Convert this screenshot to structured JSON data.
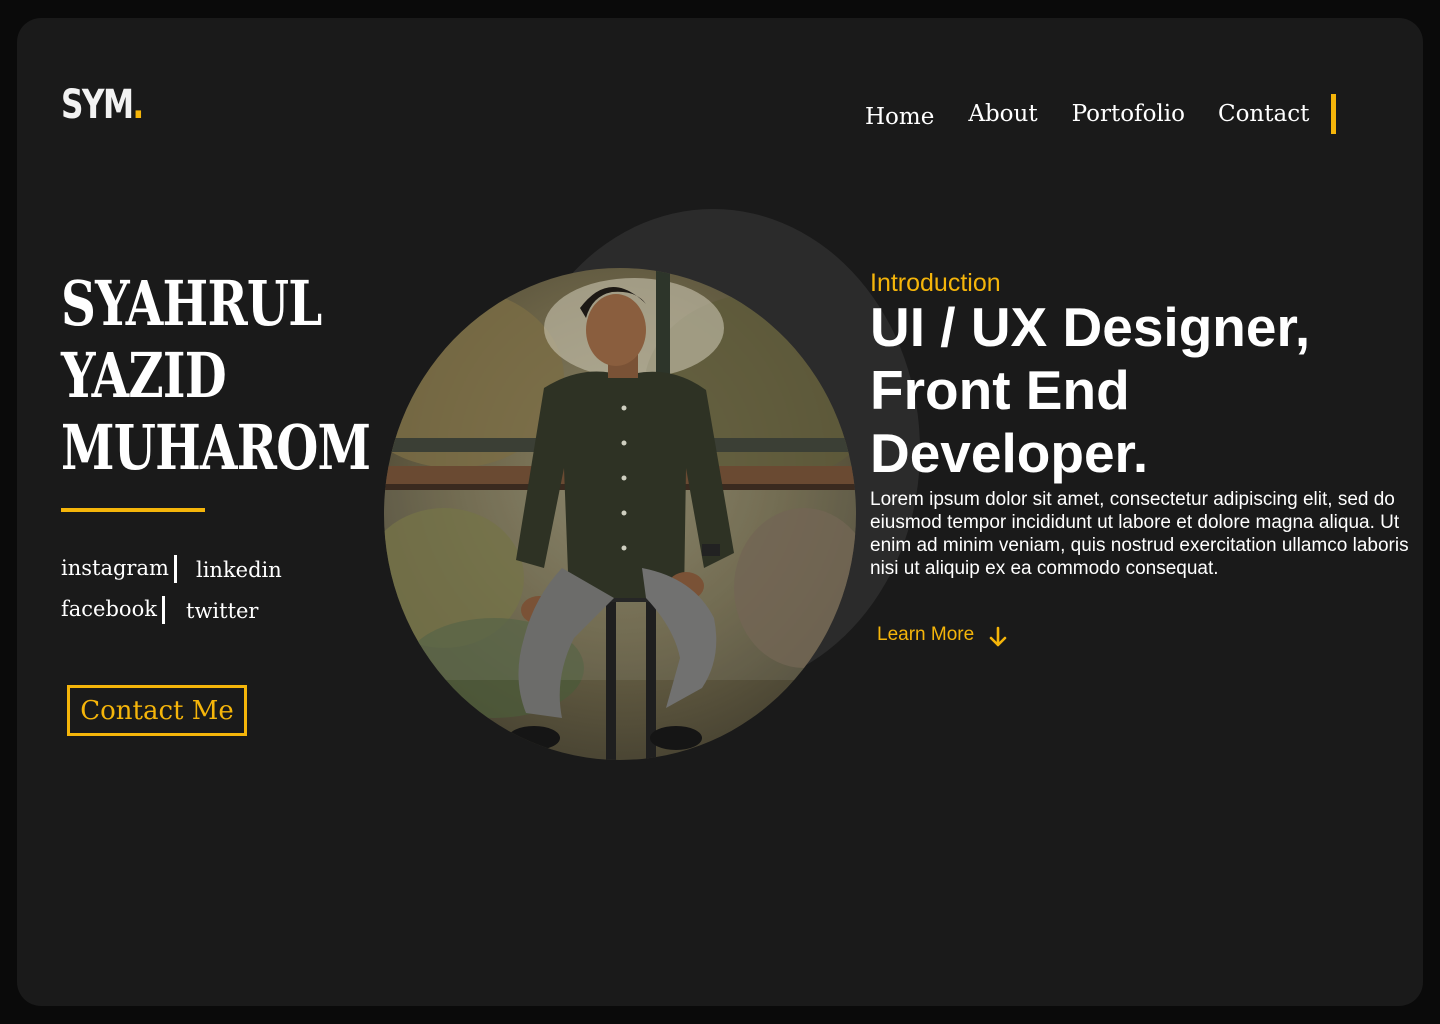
{
  "brand": {
    "logo_text": "SYM",
    "logo_dot": ".",
    "accent_color": "#f5b50a",
    "background_color": "#1a1a1a"
  },
  "nav": {
    "items": [
      {
        "label": "Home"
      },
      {
        "label": "About"
      },
      {
        "label": "Portofolio"
      },
      {
        "label": "Contact"
      }
    ]
  },
  "hero": {
    "name_lines": [
      "SYAHRUL",
      "YAZID",
      "MUHAROM"
    ],
    "socials": {
      "instagram": "instagram",
      "linkedin": "linkedin",
      "facebook": "facebook",
      "twitter": "twitter"
    },
    "contact_button": "Contact Me",
    "photo_icon": "person-portrait-photo"
  },
  "intro": {
    "label": "Introduction",
    "headline_lines": [
      "UI / UX Designer,",
      "Front End",
      "Developer."
    ],
    "paragraph": "Lorem ipsum dolor sit amet, consectetur adipiscing elit, sed do eiusmod tempor incididunt ut labore et dolore magna aliqua. Ut enim ad minim veniam, quis nostrud exercitation ullamco laboris nisi ut aliquip ex ea commodo consequat.",
    "learn_more": "Learn More",
    "learn_more_icon": "arrow-down-icon"
  }
}
